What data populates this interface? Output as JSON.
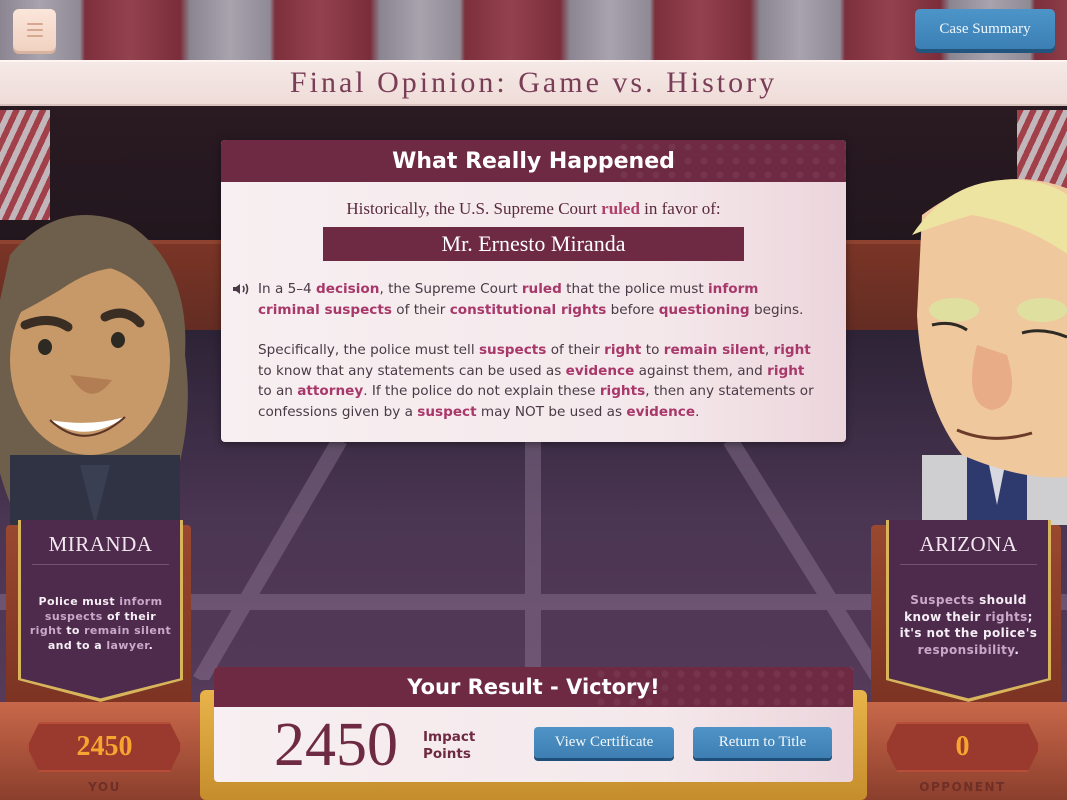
{
  "header": {
    "menu_icon": "hamburger-menu-icon",
    "case_summary_label": "Case Summary",
    "title": "Final Opinion: Game vs. History"
  },
  "history": {
    "heading": "What Really Happened",
    "intro_prefix": "Historically, the U.S. Supreme Court",
    "intro_highlight": "ruled",
    "intro_suffix": "in favor of:",
    "winner": "Mr. Ernesto Miranda",
    "audio_icon": "speaker-icon",
    "paragraph1": [
      {
        "t": "In a 5–4 ",
        "h": false
      },
      {
        "t": "decision",
        "h": true
      },
      {
        "t": ", the Supreme Court ",
        "h": false
      },
      {
        "t": "ruled",
        "h": true
      },
      {
        "t": " that the police must ",
        "h": false
      },
      {
        "t": "inform criminal suspects",
        "h": true
      },
      {
        "t": " of their ",
        "h": false
      },
      {
        "t": "constitutional rights",
        "h": true
      },
      {
        "t": " before ",
        "h": false
      },
      {
        "t": "questioning",
        "h": true
      },
      {
        "t": " begins.",
        "h": false
      }
    ],
    "paragraph2": [
      {
        "t": "Specifically, the police must tell ",
        "h": false
      },
      {
        "t": "suspects",
        "h": true
      },
      {
        "t": " of their ",
        "h": false
      },
      {
        "t": "right",
        "h": true
      },
      {
        "t": " to ",
        "h": false
      },
      {
        "t": "remain silent",
        "h": true
      },
      {
        "t": ", ",
        "h": false
      },
      {
        "t": "right",
        "h": true
      },
      {
        "t": " to know that any statements can be used as ",
        "h": false
      },
      {
        "t": "evidence",
        "h": true
      },
      {
        "t": " against them, and ",
        "h": false
      },
      {
        "t": "right",
        "h": true
      },
      {
        "t": " to an ",
        "h": false
      },
      {
        "t": "attorney",
        "h": true
      },
      {
        "t": ". If the police do not explain these ",
        "h": false
      },
      {
        "t": "rights",
        "h": true
      },
      {
        "t": ", then any statements or confessions given by a ",
        "h": false
      },
      {
        "t": "suspect",
        "h": true
      },
      {
        "t": " may NOT be used as ",
        "h": false
      },
      {
        "t": "evidence",
        "h": true
      },
      {
        "t": ".",
        "h": false
      }
    ]
  },
  "sides": {
    "left": {
      "name": "MIRANDA",
      "argument": [
        {
          "t": "Police must ",
          "h": false
        },
        {
          "t": "inform",
          "h": true
        },
        {
          "t": " ",
          "h": false
        },
        {
          "t": "suspects",
          "h": true
        },
        {
          "t": " of their ",
          "h": false
        },
        {
          "t": "right",
          "h": true
        },
        {
          "t": " to ",
          "h": false
        },
        {
          "t": "remain silent",
          "h": true
        },
        {
          "t": " and to a ",
          "h": false
        },
        {
          "t": "lawyer",
          "h": true
        },
        {
          "t": ".",
          "h": false
        }
      ],
      "score": "2450",
      "score_label": "YOU"
    },
    "right": {
      "name": "ARIZONA",
      "argument": [
        {
          "t": "Suspects",
          "h": true
        },
        {
          "t": " should know their ",
          "h": false
        },
        {
          "t": "rights",
          "h": true
        },
        {
          "t": "; it's not the police's ",
          "h": false
        },
        {
          "t": "responsibility",
          "h": true
        },
        {
          "t": ".",
          "h": false
        }
      ],
      "score": "0",
      "score_label": "OPPONENT"
    }
  },
  "result": {
    "heading": "Your Result - Victory!",
    "points": "2450",
    "points_label_line1": "Impact",
    "points_label_line2": "Points",
    "view_certificate_label": "View Certificate",
    "return_to_title_label": "Return to Title"
  },
  "colors": {
    "primary_maroon": "#6e2a42",
    "highlight": "#a8386a",
    "button_blue": "#4a8fc4",
    "score_gold": "#f7a530"
  }
}
